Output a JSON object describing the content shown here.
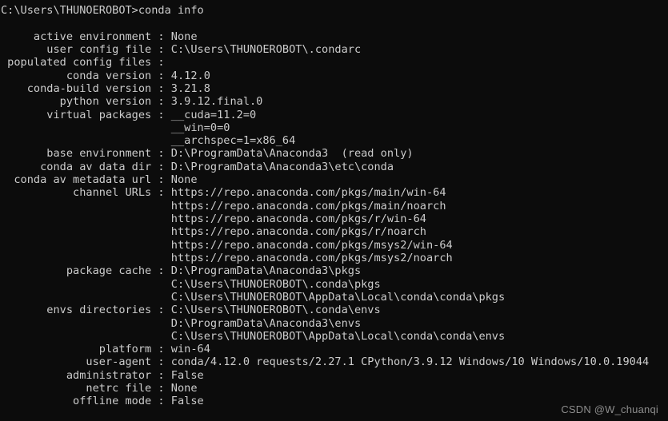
{
  "window": {
    "title": "C:\\Windows\\system32\\cmd.exe",
    "background_color": "#0c0c0c",
    "foreground_color": "#cccccc"
  },
  "terminal": {
    "prompt_line": "C:\\Users\\THUNOEROBOT>conda info",
    "prompt_path": "C:\\Users\\THUNOEROBOT",
    "prompt_symbol": ">",
    "command": "conda info",
    "label_column": 23,
    "separator": " : ",
    "rows": [
      {
        "label": "active environment",
        "values": [
          "None"
        ]
      },
      {
        "label": "user config file",
        "values": [
          "C:\\Users\\THUNOEROBOT\\.condarc"
        ]
      },
      {
        "label": "populated config files",
        "values": [
          ""
        ]
      },
      {
        "label": "conda version",
        "values": [
          "4.12.0"
        ]
      },
      {
        "label": "conda-build version",
        "values": [
          "3.21.8"
        ]
      },
      {
        "label": "python version",
        "values": [
          "3.9.12.final.0"
        ]
      },
      {
        "label": "virtual packages",
        "values": [
          "__cuda=11.2=0",
          "__win=0=0",
          "__archspec=1=x86_64"
        ]
      },
      {
        "label": "base environment",
        "values": [
          "D:\\ProgramData\\Anaconda3  (read only)"
        ]
      },
      {
        "label": "conda av data dir",
        "values": [
          "D:\\ProgramData\\Anaconda3\\etc\\conda"
        ]
      },
      {
        "label": "conda av metadata url",
        "values": [
          "None"
        ]
      },
      {
        "label": "channel URLs",
        "values": [
          "https://repo.anaconda.com/pkgs/main/win-64",
          "https://repo.anaconda.com/pkgs/main/noarch",
          "https://repo.anaconda.com/pkgs/r/win-64",
          "https://repo.anaconda.com/pkgs/r/noarch",
          "https://repo.anaconda.com/pkgs/msys2/win-64",
          "https://repo.anaconda.com/pkgs/msys2/noarch"
        ]
      },
      {
        "label": "package cache",
        "values": [
          "D:\\ProgramData\\Anaconda3\\pkgs",
          "C:\\Users\\THUNOEROBOT\\.conda\\pkgs",
          "C:\\Users\\THUNOEROBOT\\AppData\\Local\\conda\\conda\\pkgs"
        ]
      },
      {
        "label": "envs directories",
        "values": [
          "C:\\Users\\THUNOEROBOT\\.conda\\envs",
          "D:\\ProgramData\\Anaconda3\\envs",
          "C:\\Users\\THUNOEROBOT\\AppData\\Local\\conda\\conda\\envs"
        ]
      },
      {
        "label": "platform",
        "values": [
          "win-64"
        ]
      },
      {
        "label": "user-agent",
        "values": [
          "conda/4.12.0 requests/2.27.1 CPython/3.9.12 Windows/10 Windows/10.0.19044"
        ]
      },
      {
        "label": "administrator",
        "values": [
          "False"
        ]
      },
      {
        "label": "netrc file",
        "values": [
          "None"
        ]
      },
      {
        "label": "offline mode",
        "values": [
          "False"
        ]
      }
    ]
  },
  "watermark": {
    "text": "CSDN @W_chuanqi"
  }
}
